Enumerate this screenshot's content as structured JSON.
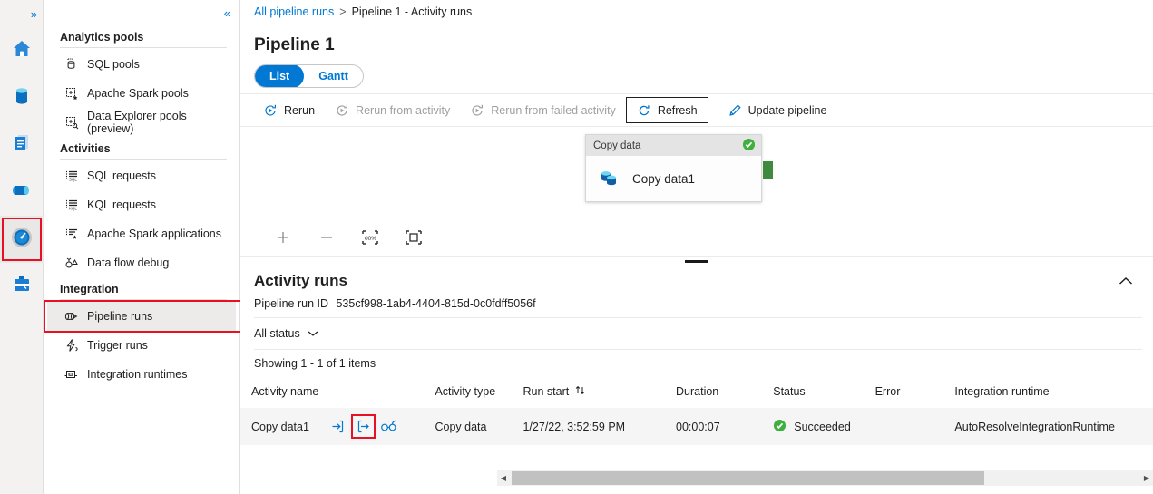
{
  "rail": {
    "expand_label": "»",
    "items": [
      {
        "name": "home",
        "icon": "home-icon",
        "selected": false
      },
      {
        "name": "data",
        "icon": "database-icon",
        "selected": false
      },
      {
        "name": "develop",
        "icon": "document-icon",
        "selected": false
      },
      {
        "name": "integrate",
        "icon": "pipeline-icon",
        "selected": false
      },
      {
        "name": "monitor",
        "icon": "gauge-icon",
        "selected": true
      },
      {
        "name": "manage",
        "icon": "toolbox-icon",
        "selected": false
      }
    ]
  },
  "sidebar": {
    "collapse_label": "«",
    "groups": [
      {
        "title": "Analytics pools",
        "items": [
          {
            "label": "SQL pools",
            "icon": "sql-pool-icon",
            "selected": false
          },
          {
            "label": "Apache Spark pools",
            "icon": "spark-pool-icon",
            "selected": false
          },
          {
            "label": "Data Explorer pools (preview)",
            "icon": "data-explorer-pool-icon",
            "selected": false
          }
        ]
      },
      {
        "title": "Activities",
        "items": [
          {
            "label": "SQL requests",
            "icon": "sql-request-icon",
            "selected": false
          },
          {
            "label": "KQL requests",
            "icon": "kql-request-icon",
            "selected": false
          },
          {
            "label": "Apache Spark applications",
            "icon": "spark-application-icon",
            "selected": false
          },
          {
            "label": "Data flow debug",
            "icon": "data-flow-debug-icon",
            "selected": false
          }
        ]
      },
      {
        "title": "Integration",
        "items": [
          {
            "label": "Pipeline runs",
            "icon": "pipeline-runs-icon",
            "selected": true
          },
          {
            "label": "Trigger runs",
            "icon": "trigger-runs-icon",
            "selected": false
          },
          {
            "label": "Integration runtimes",
            "icon": "integration-runtimes-icon",
            "selected": false
          }
        ]
      }
    ]
  },
  "breadcrumb": {
    "root": "All pipeline runs",
    "separator": ">",
    "current": "Pipeline 1 - Activity runs"
  },
  "page": {
    "title": "Pipeline 1"
  },
  "view_toggle": {
    "options": [
      "List",
      "Gantt"
    ],
    "selected": "List"
  },
  "toolbar": {
    "rerun": {
      "label": "Rerun",
      "icon": "rerun-icon",
      "disabled": false,
      "boxed": false
    },
    "rerun_from_activity": {
      "label": "Rerun from activity",
      "icon": "rerun-icon",
      "disabled": true,
      "boxed": false
    },
    "rerun_from_failed": {
      "label": "Rerun from failed activity",
      "icon": "rerun-icon",
      "disabled": true,
      "boxed": false
    },
    "refresh": {
      "label": "Refresh",
      "icon": "refresh-icon",
      "disabled": false,
      "boxed": true
    },
    "update_pipeline": {
      "label": "Update pipeline",
      "icon": "pencil-icon",
      "disabled": false,
      "boxed": false
    }
  },
  "canvas": {
    "node": {
      "header": "Copy data",
      "status_icon": "success-check-icon",
      "name": "Copy data1",
      "activity_icon": "copy-data-icon"
    },
    "zoom_controls": [
      {
        "name": "zoom-in",
        "glyph": "+"
      },
      {
        "name": "zoom-out",
        "glyph": "−"
      },
      {
        "name": "zoom-to-100",
        "glyph": "100%"
      },
      {
        "name": "zoom-to-fit",
        "glyph": "fit"
      }
    ]
  },
  "activity_runs": {
    "title": "Activity runs",
    "collapse_icon": "chevron-up-icon",
    "run_id_label": "Pipeline run ID",
    "run_id_value": "535cf998-1ab4-4404-815d-0c0fdff5056f",
    "status_filter": "All status",
    "showing": "Showing 1 - 1 of 1 items",
    "columns": [
      "Activity name",
      "Activity type",
      "Run start",
      "Duration",
      "Status",
      "Error",
      "Integration runtime"
    ],
    "sort_column": "Run start",
    "rows": [
      {
        "activity_name": "Copy data1",
        "actions": [
          "input-icon",
          "output-icon",
          "details-glasses-icon"
        ],
        "highlighted_action": "output-icon",
        "activity_type": "Copy data",
        "run_start": "1/27/22, 3:52:59 PM",
        "duration": "00:00:07",
        "status": "Succeeded",
        "status_icon": "success-check-icon",
        "error": "",
        "integration_runtime": "AutoResolveIntegrationRuntime"
      }
    ]
  },
  "colors": {
    "accent": "#0078d4",
    "success": "#107c10",
    "highlight": "#e81123",
    "port": "#3f8a3f"
  }
}
